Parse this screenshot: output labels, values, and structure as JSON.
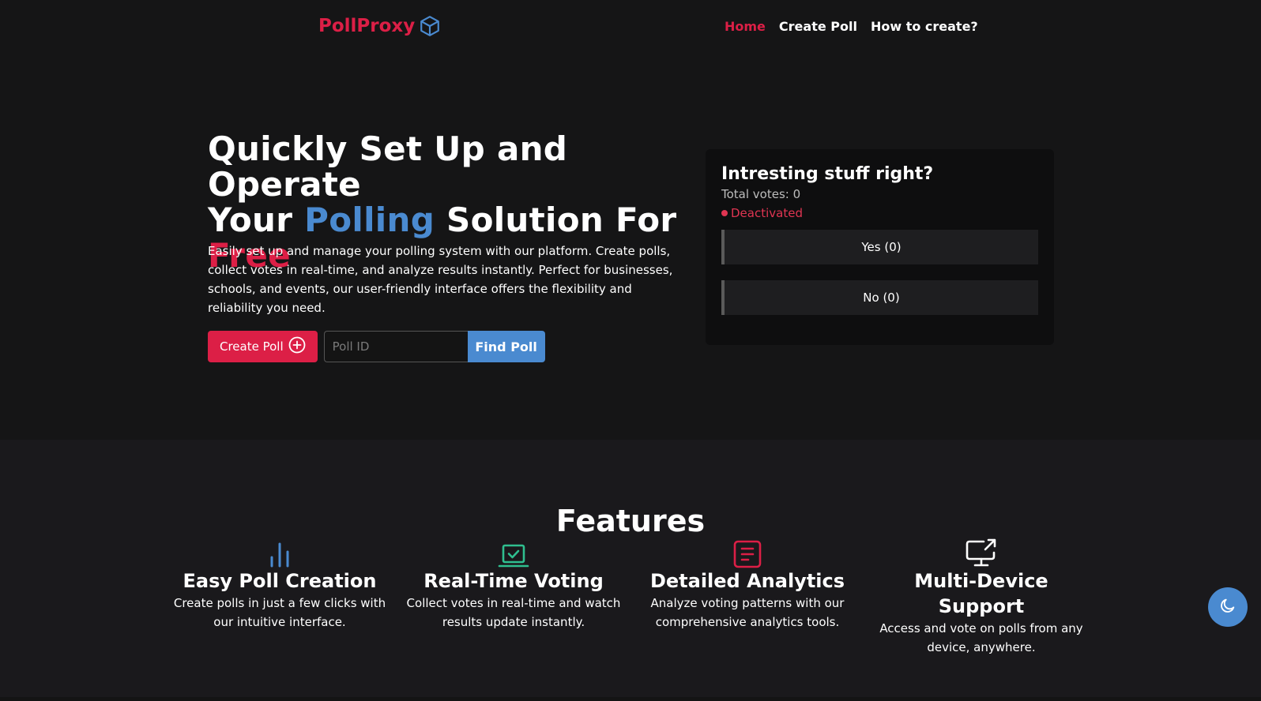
{
  "brand": {
    "name": "PollProxy",
    "icon": "cube-icon",
    "color": "#dc1f46",
    "icon_color": "#4a8ad0"
  },
  "nav": {
    "items": [
      {
        "label": "Home",
        "active": true
      },
      {
        "label": "Create Poll",
        "active": false
      },
      {
        "label": "How to create?",
        "active": false
      }
    ]
  },
  "hero": {
    "title_line1": "Quickly Set Up and Operate",
    "title_your": "Your",
    "title_polling": "Polling",
    "title_solution": "Solution For",
    "title_free": "Free",
    "description": "Easily set up and manage your polling system with our platform. Create polls, collect votes in real-time, and analyze results instantly. Perfect for businesses, schools, and events, our user-friendly interface offers the flexibility and reliability you need.",
    "create_button": "Create Poll",
    "create_icon": "plus-circle-icon",
    "poll_id_placeholder": "Poll ID",
    "find_button": "Find Poll"
  },
  "poll_card": {
    "question": "Intresting stuff right?",
    "total_votes": "Total votes: 0",
    "status": "Deactivated",
    "options": [
      {
        "label": "Yes (0)"
      },
      {
        "label": "No (0)"
      }
    ]
  },
  "features": {
    "title": "Features",
    "items": [
      {
        "icon": "bar-chart-icon",
        "title": "Easy Poll Creation",
        "description": "Create polls in just a few clicks with our intuitive interface."
      },
      {
        "icon": "laptop-check-icon",
        "title": "Real-Time Voting",
        "description": "Collect votes in real-time and watch results update instantly."
      },
      {
        "icon": "document-icon",
        "title": "Detailed Analytics",
        "description": "Analyze voting patterns with our comprehensive analytics tools."
      },
      {
        "icon": "monitor-share-icon",
        "title": "Multi-Device Support",
        "description": "Access and vote on polls from any device, anywhere."
      }
    ]
  },
  "theme_toggle": {
    "icon": "moon-icon"
  },
  "colors": {
    "accent_red": "#dc1f46",
    "accent_blue": "#4a8ad0",
    "accent_green": "#2fbf8f",
    "background": "#151516"
  }
}
